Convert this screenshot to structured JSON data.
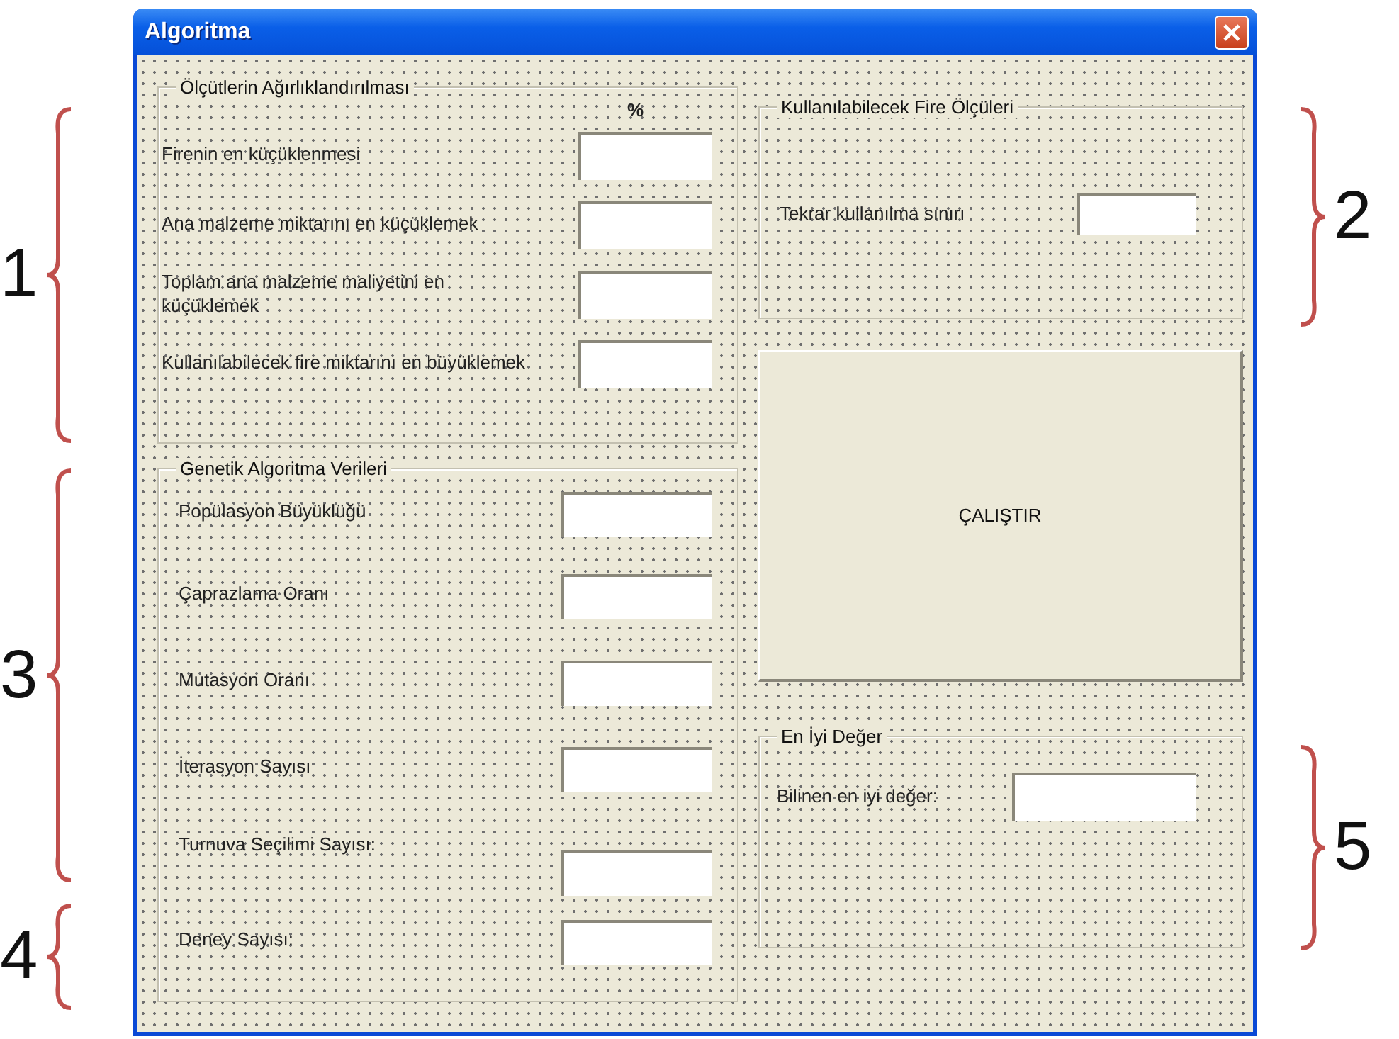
{
  "window": {
    "title": "Algoritma"
  },
  "weights": {
    "title": "Ölçütlerin Ağırlıklandırılması",
    "column_header": "%",
    "rows": [
      {
        "label": "Firenin en küçüklenmesi"
      },
      {
        "label": "Ana malzeme miktarını en küçüklemek"
      },
      {
        "label": "Toplam ana malzeme maliyetini en küçüklemek"
      },
      {
        "label": "Kullanılabilecek fire miktarını en büyüklemek"
      }
    ]
  },
  "genetic": {
    "title": "Genetik Algoritma Verileri",
    "rows": [
      {
        "label": "Popülasyon Büyüklüğü"
      },
      {
        "label": "Çaprazlama Oranı"
      },
      {
        "label": "Mutasyon Oranı"
      },
      {
        "label": "İterasyon Sayısı"
      },
      {
        "label": "Turnuva Seçilimi Sayısı:"
      },
      {
        "label": "Deney Sayısı:"
      }
    ]
  },
  "waste": {
    "title": "Kullanılabilecek Fire Ölçüleri",
    "label": "Tekrar kullanılma sınırı"
  },
  "run_button": {
    "label": "ÇALIŞTIR"
  },
  "best": {
    "title": "En İyi Değer",
    "label": "Bilinen en iyi değer:"
  },
  "annotations": {
    "left": [
      {
        "label": "1"
      },
      {
        "label": "3"
      },
      {
        "label": "4"
      }
    ],
    "right": [
      {
        "label": "2"
      },
      {
        "label": "5"
      }
    ]
  }
}
